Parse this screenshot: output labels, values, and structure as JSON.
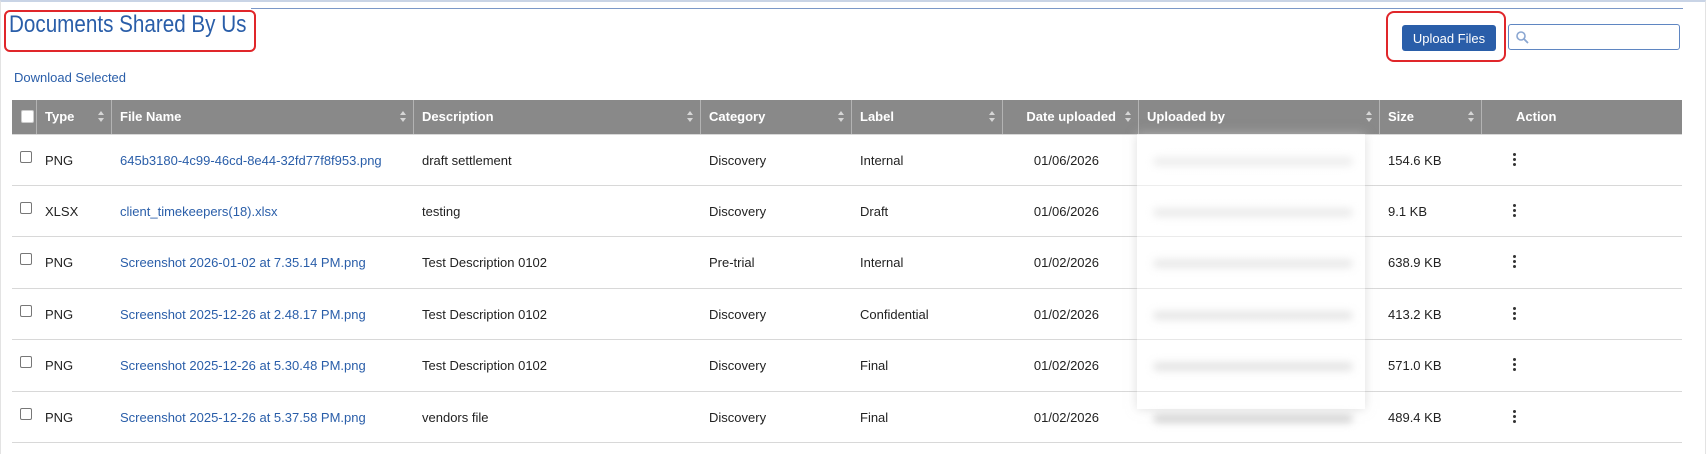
{
  "header": {
    "title": "Documents Shared By Us",
    "upload_label": "Upload Files",
    "search_placeholder": "",
    "download_selected": "Download Selected"
  },
  "table": {
    "columns": [
      {
        "key": "type",
        "label": "Type"
      },
      {
        "key": "file_name",
        "label": "File Name"
      },
      {
        "key": "description",
        "label": "Description"
      },
      {
        "key": "category",
        "label": "Category"
      },
      {
        "key": "label",
        "label": "Label"
      },
      {
        "key": "date_uploaded",
        "label": "Date uploaded"
      },
      {
        "key": "uploaded_by",
        "label": "Uploaded by"
      },
      {
        "key": "size",
        "label": "Size"
      },
      {
        "key": "action",
        "label": "Action"
      }
    ],
    "rows": [
      {
        "type": "PNG",
        "file_name": "645b3180-4c99-46cd-8e44-32fd77f8f953.png",
        "description": "draft settlement",
        "category": "Discovery",
        "label": "Internal",
        "date_uploaded": "01/06/2026",
        "size": "154.6 KB"
      },
      {
        "type": "XLSX",
        "file_name": "client_timekeepers(18).xlsx",
        "description": "testing",
        "category": "Discovery",
        "label": "Draft",
        "date_uploaded": "01/06/2026",
        "size": "9.1 KB"
      },
      {
        "type": "PNG",
        "file_name": "Screenshot 2026-01-02 at 7.35.14 PM.png",
        "description": "Test Description 0102",
        "category": "Pre-trial",
        "label": "Internal",
        "date_uploaded": "01/02/2026",
        "size": "638.9 KB"
      },
      {
        "type": "PNG",
        "file_name": "Screenshot 2025-12-26 at 2.48.17 PM.png",
        "description": "Test Description 0102",
        "category": "Discovery",
        "label": "Confidential",
        "date_uploaded": "01/02/2026",
        "size": "413.2 KB"
      },
      {
        "type": "PNG",
        "file_name": "Screenshot 2025-12-26 at 5.30.48 PM.png",
        "description": "Test Description 0102",
        "category": "Discovery",
        "label": "Final",
        "date_uploaded": "01/02/2026",
        "size": "571.0 KB"
      },
      {
        "type": "PNG",
        "file_name": "Screenshot 2025-12-26 at 5.37.58 PM.png",
        "description": "vendors file",
        "category": "Discovery",
        "label": "Final",
        "date_uploaded": "01/02/2026",
        "size": "489.4 KB"
      }
    ]
  },
  "colors": {
    "accent": "#2a5ea9",
    "header_bg": "#898989",
    "highlight": "#e0262a"
  },
  "icons": {
    "search": "search-icon",
    "row_action": "kebab-menu-icon",
    "sort": "sort-arrows-icon"
  }
}
